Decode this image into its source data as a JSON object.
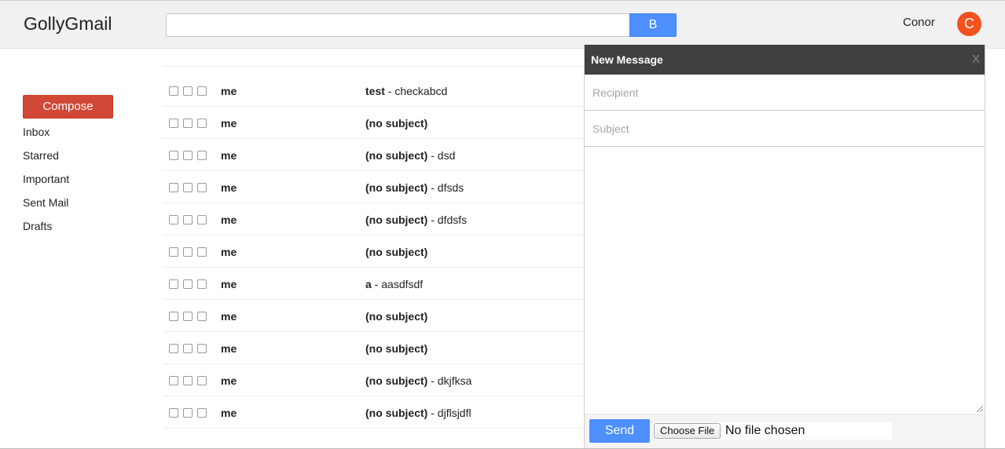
{
  "app": {
    "title": "GollyGmail"
  },
  "search": {
    "value": "",
    "placeholder": "",
    "button_label": "B"
  },
  "user": {
    "name": "Conor",
    "avatar_initial": "C",
    "avatar_color": "#f4511e"
  },
  "sidebar": {
    "compose_label": "Compose",
    "items": [
      {
        "label": "Inbox"
      },
      {
        "label": "Starred"
      },
      {
        "label": "Important"
      },
      {
        "label": "Sent Mail"
      },
      {
        "label": "Drafts"
      }
    ]
  },
  "emails": [
    {
      "sender": "me",
      "subject": "test",
      "snippet": "checkabcd"
    },
    {
      "sender": "me",
      "subject": "(no subject)",
      "snippet": ""
    },
    {
      "sender": "me",
      "subject": "(no subject)",
      "snippet": "dsd"
    },
    {
      "sender": "me",
      "subject": "(no subject)",
      "snippet": "dfsds"
    },
    {
      "sender": "me",
      "subject": "(no subject)",
      "snippet": "dfdsfs"
    },
    {
      "sender": "me",
      "subject": "(no subject)",
      "snippet": ""
    },
    {
      "sender": "me",
      "subject": "a",
      "snippet": "aasdfsdf"
    },
    {
      "sender": "me",
      "subject": "(no subject)",
      "snippet": ""
    },
    {
      "sender": "me",
      "subject": "(no subject)",
      "snippet": ""
    },
    {
      "sender": "me",
      "subject": "(no subject)",
      "snippet": "dkjfksa"
    },
    {
      "sender": "me",
      "subject": "(no subject)",
      "snippet": "djflsjdfl"
    }
  ],
  "compose": {
    "title": "New Message",
    "close_label": "X",
    "recipient_placeholder": "Recipient",
    "subject_placeholder": "Subject",
    "body_value": "",
    "send_label": "Send",
    "file_button_label": "Choose File",
    "file_status": "No file chosen"
  },
  "colors": {
    "accent_blue": "#4d90fe",
    "compose_red": "#d14836",
    "header_dark": "#404040"
  }
}
